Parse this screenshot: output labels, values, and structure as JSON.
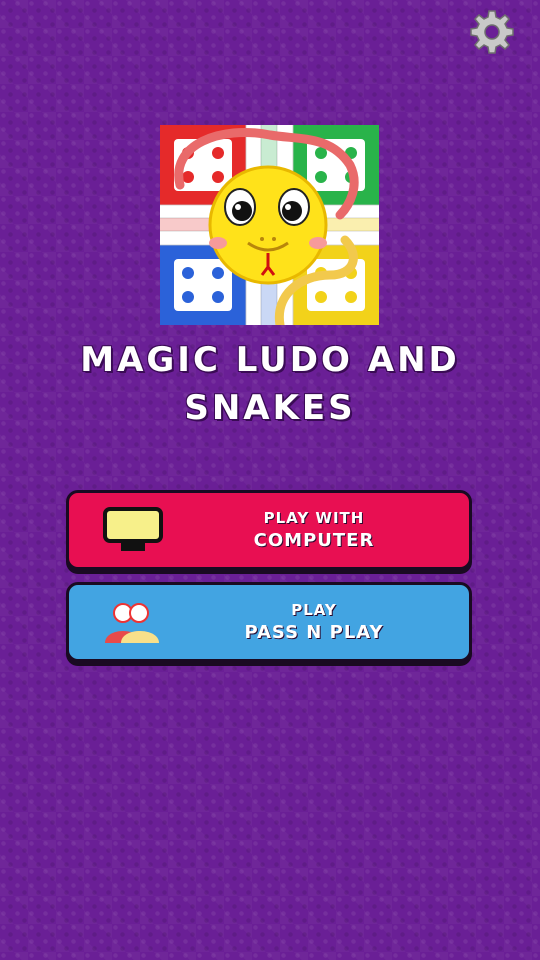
{
  "app": {
    "title_line1": "MAGIC LUDO AND",
    "title_line2": "SNAKES"
  },
  "icons": {
    "settings": "gear-icon",
    "logo": "ludo-snake-logo",
    "computer": "computer-monitor-icon",
    "users": "two-players-icon"
  },
  "buttons": {
    "computer": {
      "line1": "PLAY WITH",
      "line2": "COMPUTER"
    },
    "pass": {
      "line1": "PLAY",
      "line2": "PASS N PLAY"
    }
  },
  "colors": {
    "background": "#6a1f96",
    "computer_button": "#e80f52",
    "pass_button": "#42a4e2",
    "ludo_red": "#e52a2a",
    "ludo_green": "#29b34a",
    "ludo_blue": "#2b62d9",
    "ludo_yellow": "#f2d21a"
  }
}
